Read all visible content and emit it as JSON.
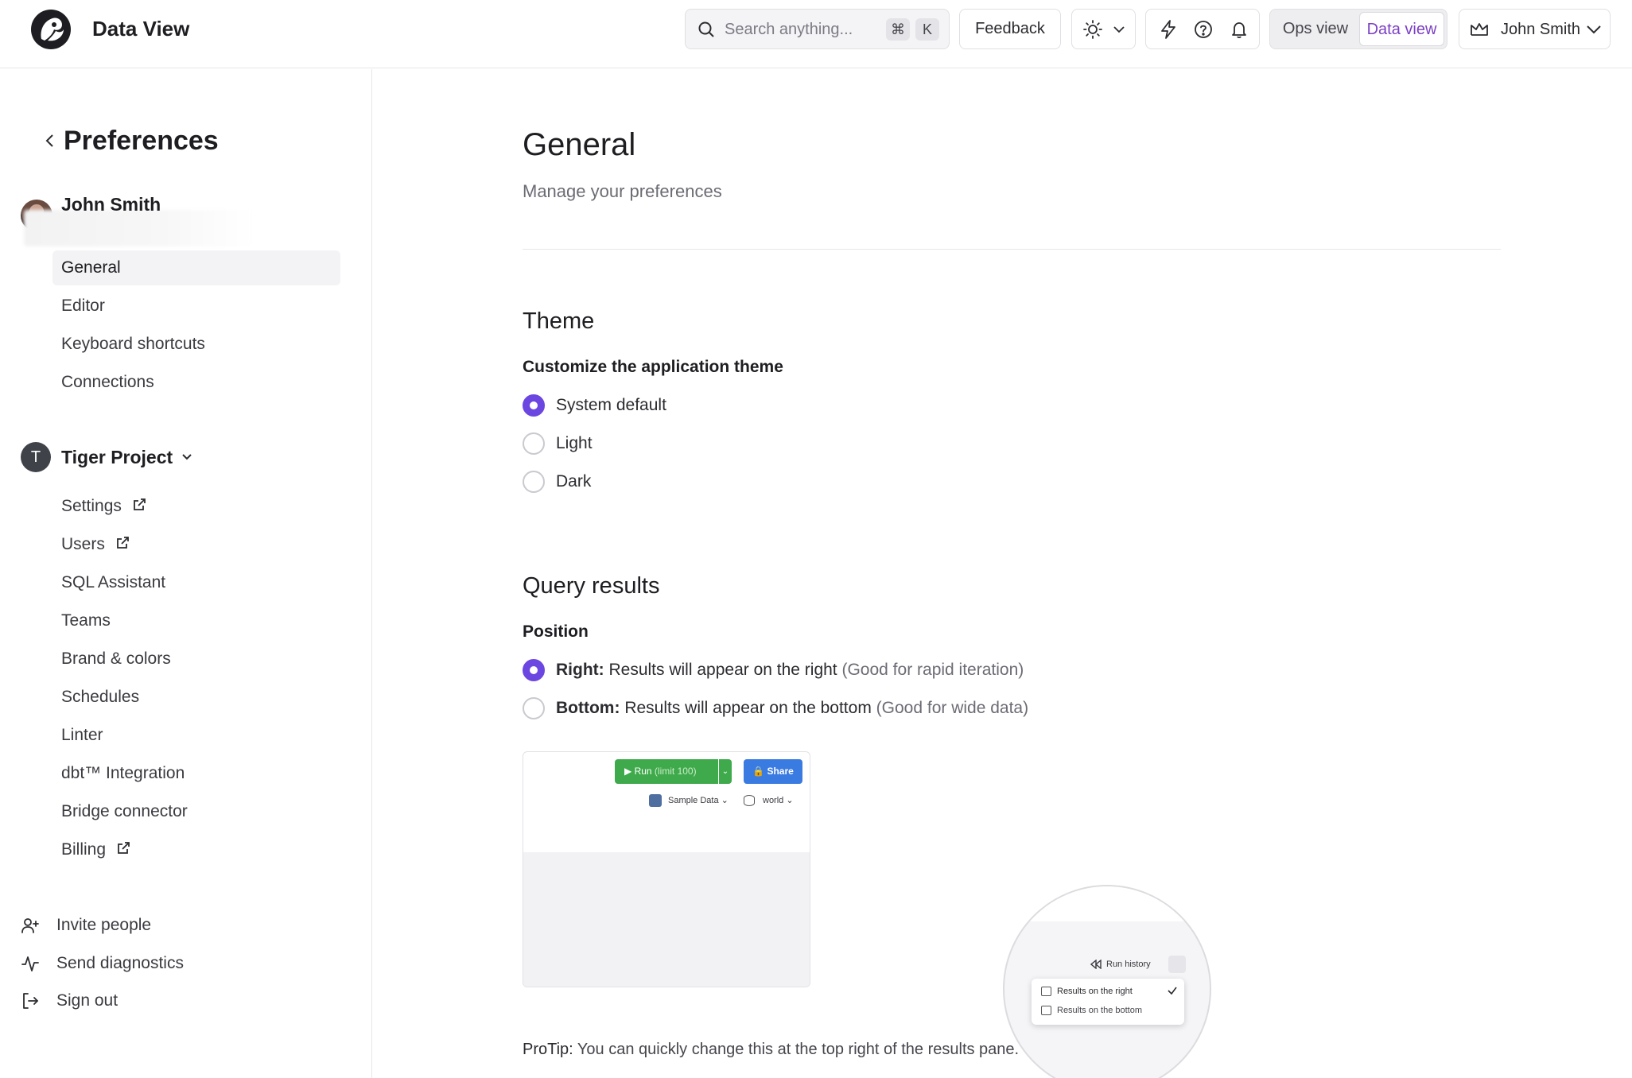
{
  "header": {
    "app_title": "Data View",
    "search_placeholder": "Search anything...",
    "search_key_1": "⌘",
    "search_key_2": "K",
    "feedback_label": "Feedback",
    "view_ops_label": "Ops view",
    "view_data_label": "Data view",
    "user_name": "John Smith"
  },
  "sidebar": {
    "title": "Preferences",
    "user_name": "John Smith",
    "items": [
      {
        "label": "General",
        "active": true
      },
      {
        "label": "Editor"
      },
      {
        "label": "Keyboard shortcuts"
      },
      {
        "label": "Connections"
      }
    ],
    "project": {
      "initial": "T",
      "name": "Tiger Project",
      "items": [
        {
          "label": "Settings",
          "external": true
        },
        {
          "label": "Users",
          "external": true
        },
        {
          "label": "SQL Assistant"
        },
        {
          "label": "Teams"
        },
        {
          "label": "Brand & colors"
        },
        {
          "label": "Schedules"
        },
        {
          "label": "Linter"
        },
        {
          "label": "dbt™ Integration"
        },
        {
          "label": "Bridge connector"
        },
        {
          "label": "Billing",
          "external": true
        }
      ]
    },
    "footer": [
      {
        "label": "Invite people",
        "icon": "user-plus-icon"
      },
      {
        "label": "Send diagnostics",
        "icon": "activity-icon"
      },
      {
        "label": "Sign out",
        "icon": "sign-out-icon"
      }
    ]
  },
  "main": {
    "title": "General",
    "subtitle": "Manage your preferences",
    "theme": {
      "title": "Theme",
      "label": "Customize the application theme",
      "options": [
        "System default",
        "Light",
        "Dark"
      ],
      "selected": "System default"
    },
    "query_results": {
      "title": "Query results",
      "label": "Position",
      "options": [
        {
          "strong": "Right:",
          "text": " Results will appear on the right ",
          "hint": "(Good for rapid iteration)"
        },
        {
          "strong": "Bottom:",
          "text": " Results will appear on the bottom ",
          "hint": "(Good for wide data)"
        }
      ],
      "selected": "Right"
    },
    "illustration": {
      "run_label": "Run",
      "run_limit": "(limit 100)",
      "share_label": "Share",
      "source_label": "Sample Data",
      "schema_label": "world",
      "run_history_label": "Run history",
      "menu_right": "Results on the right",
      "menu_bottom": "Results on the bottom"
    },
    "protip_strong": "ProTip:",
    "protip_text": " You can quickly change this at the top right of the results pane."
  },
  "colors": {
    "accent": "#6b46e0",
    "data_view_text": "#7b3fc4",
    "run_green": "#3faa4b",
    "share_blue": "#3a7be2"
  }
}
